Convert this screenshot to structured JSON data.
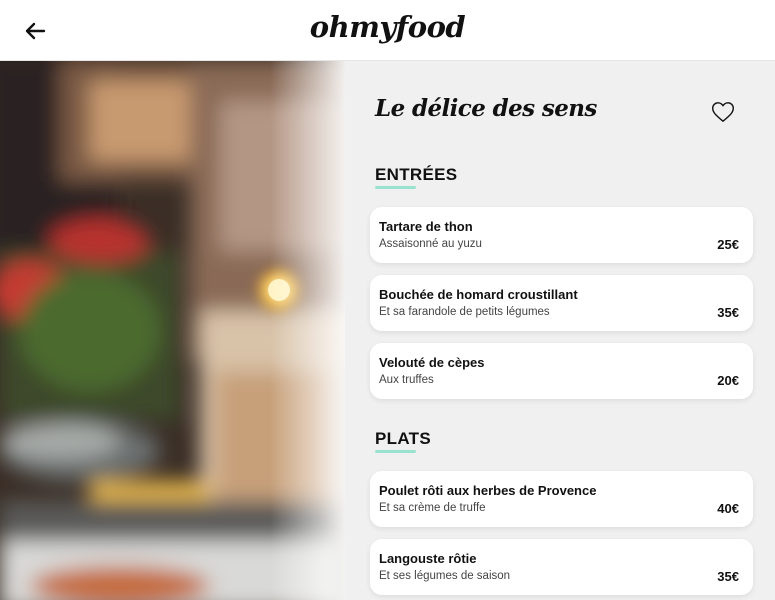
{
  "header": {
    "brand": "ohmyfood",
    "back_icon": "arrow-left-icon"
  },
  "restaurant": {
    "title": "Le délice des sens",
    "favorite_icon": "heart-outline-icon"
  },
  "sections": [
    {
      "title": "ENTRÉES",
      "accent_color": "#99e2d0",
      "items": [
        {
          "name": "Tartare de thon",
          "description": "Assaisonné au yuzu",
          "price": "25€"
        },
        {
          "name": "Bouchée de homard croustillant",
          "description": "Et sa farandole de petits légumes",
          "price": "35€"
        },
        {
          "name": "Velouté de cèpes",
          "description": "Aux truffes",
          "price": "20€"
        }
      ]
    },
    {
      "title": "PLATS",
      "accent_color": "#99e2d0",
      "items": [
        {
          "name": "Poulet rôti aux herbes de Provence",
          "description": "Et sa crème de truffe",
          "price": "40€"
        },
        {
          "name": "Langouste rôtie",
          "description": "Et ses légumes de saison",
          "price": "35€"
        }
      ]
    }
  ]
}
